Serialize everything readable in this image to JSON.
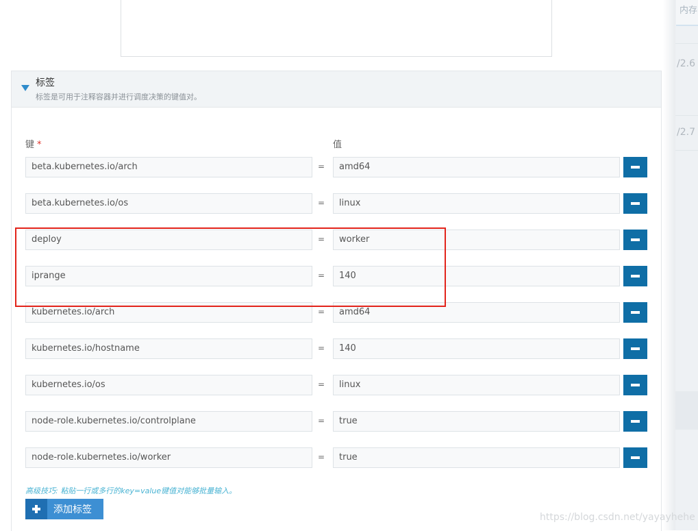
{
  "background": {
    "tab_label": "内存",
    "values": [
      "/2.6",
      "/2.7"
    ]
  },
  "labels_section": {
    "title": "标签",
    "description": "标签是可用于注释容器并进行调度决策的键值对。",
    "key_header": "键",
    "required_mark": "*",
    "value_header": "值",
    "equals": "=",
    "rows": [
      {
        "key": "beta.kubernetes.io/arch",
        "value": "amd64"
      },
      {
        "key": "beta.kubernetes.io/os",
        "value": "linux"
      },
      {
        "key": "deploy",
        "value": "worker"
      },
      {
        "key": "iprange",
        "value": "140"
      },
      {
        "key": "kubernetes.io/arch",
        "value": "amd64"
      },
      {
        "key": "kubernetes.io/hostname",
        "value": "140"
      },
      {
        "key": "kubernetes.io/os",
        "value": "linux"
      },
      {
        "key": "node-role.kubernetes.io/controlplane",
        "value": "true"
      },
      {
        "key": "node-role.kubernetes.io/worker",
        "value": "true"
      }
    ],
    "tip": "高级技巧: 粘贴一行或多行的key=value键值对能够批量输入。",
    "add_button_label": "添加标签"
  },
  "watermark": "https://blog.csdn.net/yayayhehe",
  "colors": {
    "primary_button": "#0f6ea6",
    "add_button": "#3d8fd3",
    "highlight": "#e2231a",
    "tip": "#49b3d3"
  }
}
